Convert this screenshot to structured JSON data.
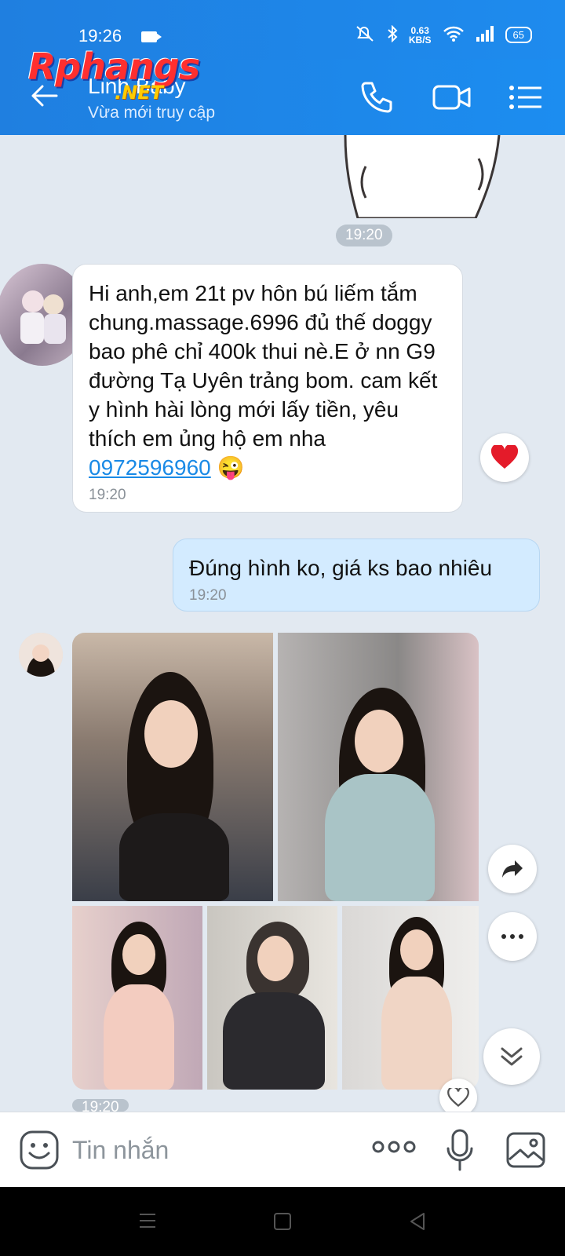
{
  "status": {
    "time": "19:26",
    "net_speed_value": "0.63",
    "net_speed_unit": "KB/S",
    "battery": "65"
  },
  "header": {
    "contact_name": "Linh Baby",
    "contact_status": "Vừa mới truy cập",
    "watermark_main": "Rphangs",
    "watermark_net": ".NET"
  },
  "messages": {
    "sticker_time": "19:20",
    "incoming": {
      "text": "Hi anh,em 21t pv hôn bú liếm tắm chung.massage.6996 đủ thế doggy bao phê chỉ 400k thui nè.E ở nn G9 đường Tạ Uyên trảng bom. cam kết y hình hài lòng mới lấy tiền, yêu thích em ủng hộ em nha ",
      "phone": "0972596960",
      "emoji": "😜",
      "time": "19:20"
    },
    "outgoing": {
      "text": "Đúng hình ko, giá ks bao nhiêu",
      "time": "19:20"
    },
    "photo_time_partial": "19:20"
  },
  "input": {
    "placeholder": "Tin nhắn"
  },
  "colors": {
    "header": "#1e88ee",
    "link": "#1a8ae6",
    "outgoing_bubble": "#d3ebff",
    "chat_bg": "#e2e9f1"
  },
  "icons": [
    "back-arrow-icon",
    "phone-icon",
    "video-call-icon",
    "menu-list-icon",
    "heart-icon",
    "share-icon",
    "more-icon",
    "scroll-down-icon",
    "emoji-icon",
    "more-dots-icon",
    "microphone-icon",
    "gallery-icon"
  ]
}
